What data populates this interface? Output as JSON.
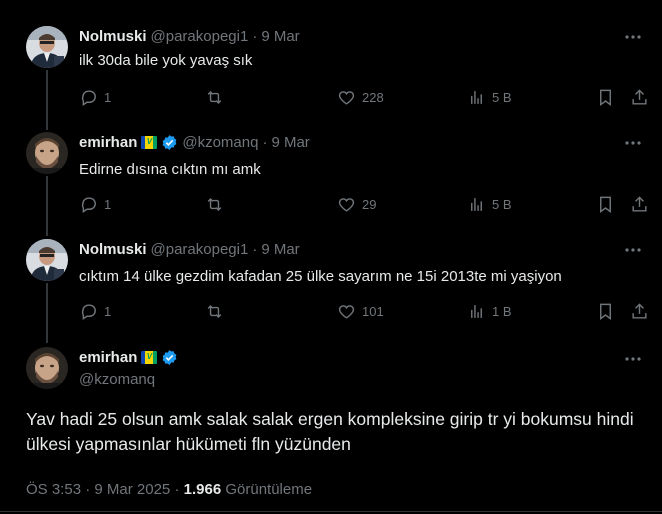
{
  "tweets": [
    {
      "name": "Nolmuski",
      "handle": "@parakopegi1",
      "separator": "·",
      "date": "9 Mar",
      "text": "ilk 30da bile yok yavaş sık",
      "replies": "1",
      "retweets": "",
      "likes": "228",
      "views": "5 B"
    },
    {
      "name": "emirhan",
      "handle": "@kzomanq",
      "separator": "·",
      "date": "9 Mar",
      "text": "Edirne dısına cıktın mı amk",
      "replies": "1",
      "retweets": "",
      "likes": "29",
      "views": "5 B"
    },
    {
      "name": "Nolmuski",
      "handle": "@parakopegi1",
      "separator": "·",
      "date": "9 Mar",
      "text": "cıktım 14 ülke gezdim kafadan 25 ülke sayarım ne 15i 2013te mi yaşiyon",
      "replies": "1",
      "retweets": "",
      "likes": "101",
      "views": "1 B"
    }
  ],
  "main_tweet": {
    "name": "emirhan",
    "handle": "@kzomanq",
    "text": "Yav hadi 25 olsun amk salak salak ergen kompleksine girip tr yi bokumsu hindi ülkesi yapmasınlar hükümeti fln yüzünden",
    "time": "ÖS 3:53",
    "separator": "·",
    "date": "9 Mar 2025",
    "view_count": "1.966",
    "view_label": "Görüntüleme"
  },
  "flag_letter": "V",
  "colors": {
    "background": "#000000",
    "text": "#e7e9ea",
    "muted": "#71767b",
    "verified": "#1d9bf0"
  }
}
